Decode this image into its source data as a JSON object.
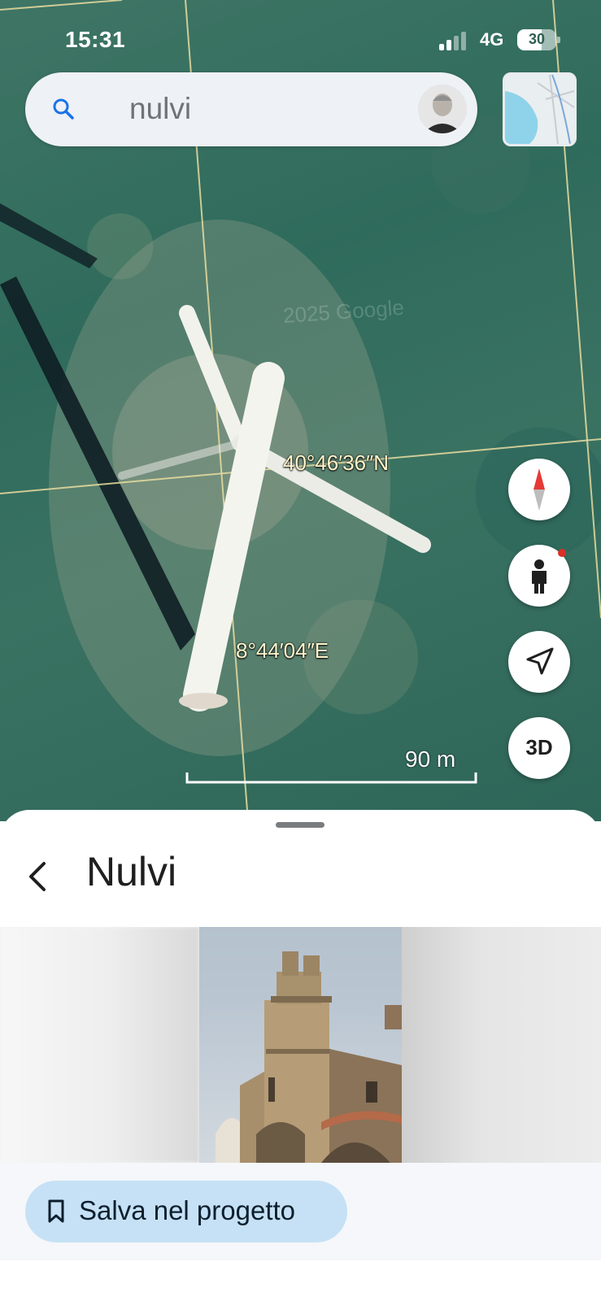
{
  "status_bar": {
    "time": "15:31",
    "network": "4G",
    "battery": "30"
  },
  "search": {
    "query": "nulvi"
  },
  "map": {
    "latitude_label": "40°46′36″N",
    "longitude_label": "8°44′04″E",
    "scale_label": "90 m",
    "watermark": "2025 Google",
    "buttons": {
      "view_3d": "3D"
    }
  },
  "place": {
    "title": "Nulvi"
  },
  "actions": {
    "save_label": "Salva nel progetto"
  },
  "colors": {
    "accent": "#1a73e8",
    "compass_red": "#e53935",
    "save_bg": "#c6e1f5",
    "notify_dot": "#d93025"
  },
  "icons": [
    "search-icon",
    "compass-icon",
    "pegman-icon",
    "navigate-arrow-icon",
    "back-chevron-icon",
    "bookmark-icon"
  ]
}
